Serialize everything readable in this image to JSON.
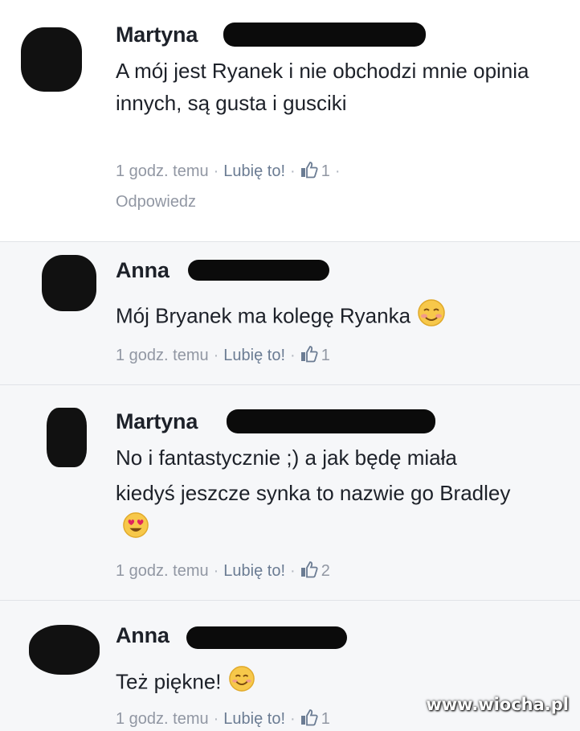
{
  "comments": [
    {
      "author": "Martyna",
      "text": "A mój jest Ryanek i nie obchodzi mnie opinia innych, są gusta i gusciki",
      "time": "1 godz. temu",
      "like_label": "Lubię to!",
      "like_count": "1",
      "reply_label": "Odpowiedz"
    },
    {
      "author": "Anna",
      "text": "Mój Bryanek ma kolegę Ryanka",
      "time": "1 godz. temu",
      "like_label": "Lubię to!",
      "like_count": "1"
    },
    {
      "author": "Martyna",
      "text": "No i fantastycznie ;) a jak będę miała kiedyś jeszcze synka to nazwie go Bradley",
      "time": "1 godz. temu",
      "like_label": "Lubię to!",
      "like_count": "2"
    },
    {
      "author": "Anna",
      "text": "Też piękne!",
      "time": "1 godz. temu",
      "like_label": "Lubię to!",
      "like_count": "1"
    }
  ],
  "watermark": "www.wiocha.pl",
  "colors": {
    "meta": "#9197a3",
    "link": "#6b7c93",
    "text": "#1d2129",
    "redaction": "#0b0b0b"
  },
  "icons": [
    "thumbs-up-icon",
    "blushing-smile-emoji",
    "heart-eyes-emoji",
    "smile-emoji"
  ]
}
